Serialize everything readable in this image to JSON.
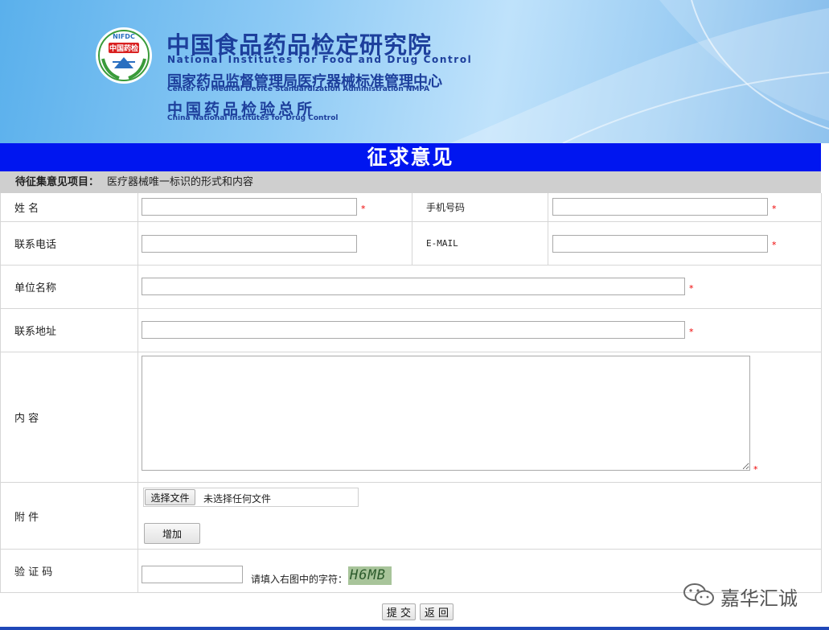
{
  "header": {
    "logo_badge_text": "NIFDC",
    "logo_inner_text": "中国药检",
    "title_cn": "中国食品药品检定研究院",
    "title_en": "National Institutes for Food and Drug Control",
    "center_cn": "国家药品监督管理局医疗器械标准管理中心",
    "center_en": "Center for Medical Device Standardization Administration NMPA",
    "inst_cn": "中国药品检验总所",
    "inst_en": "China National Institutes for Drug Control"
  },
  "page_title": "征求意见",
  "subject": {
    "label": "待征集意见项目：",
    "value": "医疗器械唯一标识的形式和内容"
  },
  "form": {
    "name_label": "姓 名",
    "mobile_label": "手机号码",
    "phone_label": "联系电话",
    "email_label": "E-MAIL",
    "org_label": "单位名称",
    "address_label": "联系地址",
    "content_label": "内 容",
    "attachment_label": "附 件",
    "captcha_label": "验 证 码",
    "required_mark": "*",
    "name_value": "",
    "mobile_value": "",
    "phone_value": "",
    "email_value": "",
    "org_value": "",
    "address_value": "",
    "content_value": "",
    "captcha_value": ""
  },
  "attachment": {
    "choose_file_button": "选择文件",
    "file_status": "未选择任何文件",
    "add_button": "增加"
  },
  "captcha": {
    "hint": "请填入右图中的字符：",
    "image_text": "H6MB"
  },
  "actions": {
    "submit_button": "提 交",
    "back_button": "返 回"
  },
  "watermark": "嘉华汇诚",
  "colors": {
    "title_bar": "#0016f0",
    "subject_bar": "#cfcfcf",
    "required": "#ee0000",
    "banner_text": "#1d3f9c",
    "banner_sky": "#8fcbf5"
  }
}
